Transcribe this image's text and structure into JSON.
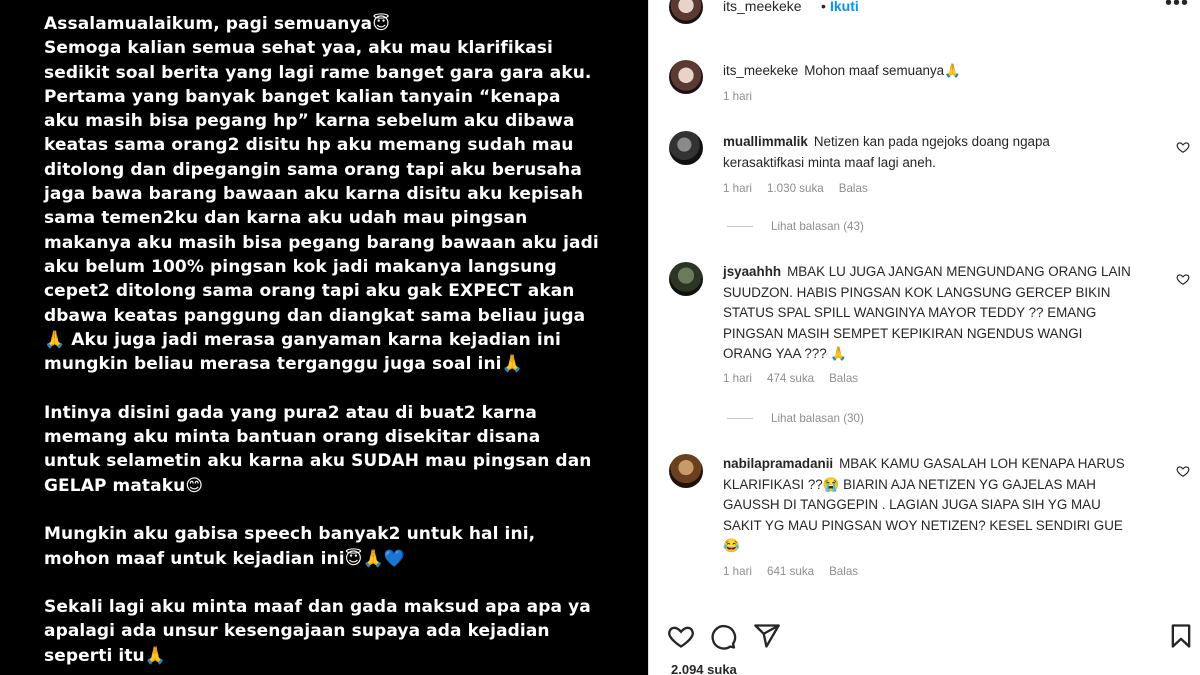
{
  "story": {
    "text": "Assalamualaikum, pagi semuanya😇\nSemoga kalian semua sehat yaa, aku mau klarifikasi\nsedikit soal berita yang lagi rame banget gara gara aku.\nPertama yang banyak banget kalian tanyain “kenapa\naku masih bisa pegang hp” karna sebelum aku dibawa\nkeatas sama orang2 disitu hp aku memang sudah mau\nditolong dan dipegangin sama orang tapi aku berusaha\njaga bawa barang bawaan aku karna disitu aku kepisah\nsama temen2ku dan karna aku udah mau pingsan\nmakanya aku masih bisa pegang barang bawaan aku jadi\naku belum 100% pingsan kok jadi makanya langsung\ncepet2 ditolong sama orang tapi aku gak EXPECT akan\ndbawa keatas panggung dan diangkat sama beliau juga\n🙏 Aku juga jadi merasa ganyaman karna kejadian ini\nmungkin beliau merasa terganggu juga soal ini🙏\n\nIntinya disini gada yang pura2 atau di buat2 karna\nmemang aku minta bantuan orang disekitar disana\nuntuk selametin aku karna aku SUDAH mau pingsan dan\nGELAP mataku😊\n\nMungkin aku gabisa speech banyak2 untuk hal ini,\nmohon maaf untuk kejadian ini😇🙏💙\n\nSekali lagi aku minta maaf dan gada maksud apa apa ya\napalagi ada unsur kesengajaan supaya ada kejadian\nseperti itu🙏"
  },
  "header": {
    "username": "its_meekeke",
    "dot": "•",
    "follow_label": "Ikuti",
    "more_label": "•••"
  },
  "caption": {
    "username": "its_meekeke",
    "text": "Mohon maaf semuanya🙏",
    "time": "1 hari"
  },
  "comments": [
    {
      "username": "muallimmalik",
      "text": "Netizen kan pada ngejoks doang ngapa kerasaktifkasi minta maaf lagi aneh.",
      "time": "1 hari",
      "likes": "1.030 suka",
      "reply_label": "Balas",
      "view_replies": "Lihat balasan (43)"
    },
    {
      "username": "jsyaahhh",
      "text": "MBAK LU JUGA JANGAN MENGUNDANG ORANG LAIN SUUDZON. HABIS PINGSAN KOK LANGSUNG GERCEP BIKIN STATUS SPAL SPILL WANGINYA MAYOR TEDDY ?? EMANG PINGSAN MASIH SEMPET KEPIKIRAN NGENDUS WANGI ORANG YAA ??? 🙏",
      "time": "1 hari",
      "likes": "474 suka",
      "reply_label": "Balas",
      "view_replies": "Lihat balasan (30)"
    },
    {
      "username": "nabilapramadanii",
      "text": "MBAK KAMU GASALAH LOH KENAPA HARUS KLARIFIKASI ??😭 BIARIN AJA NETIZEN YG GAJELAS MAH GAUSSH DI TANGGEPIN . LAGIAN JUGA SIAPA SIH YG MAU SAKIT YG MAU PINGSAN WOY NETIZEN? KESEL SENDIRI GUE😂",
      "time": "1 hari",
      "likes": "641 suka",
      "reply_label": "Balas"
    }
  ],
  "likes_count": "2.094 suka"
}
